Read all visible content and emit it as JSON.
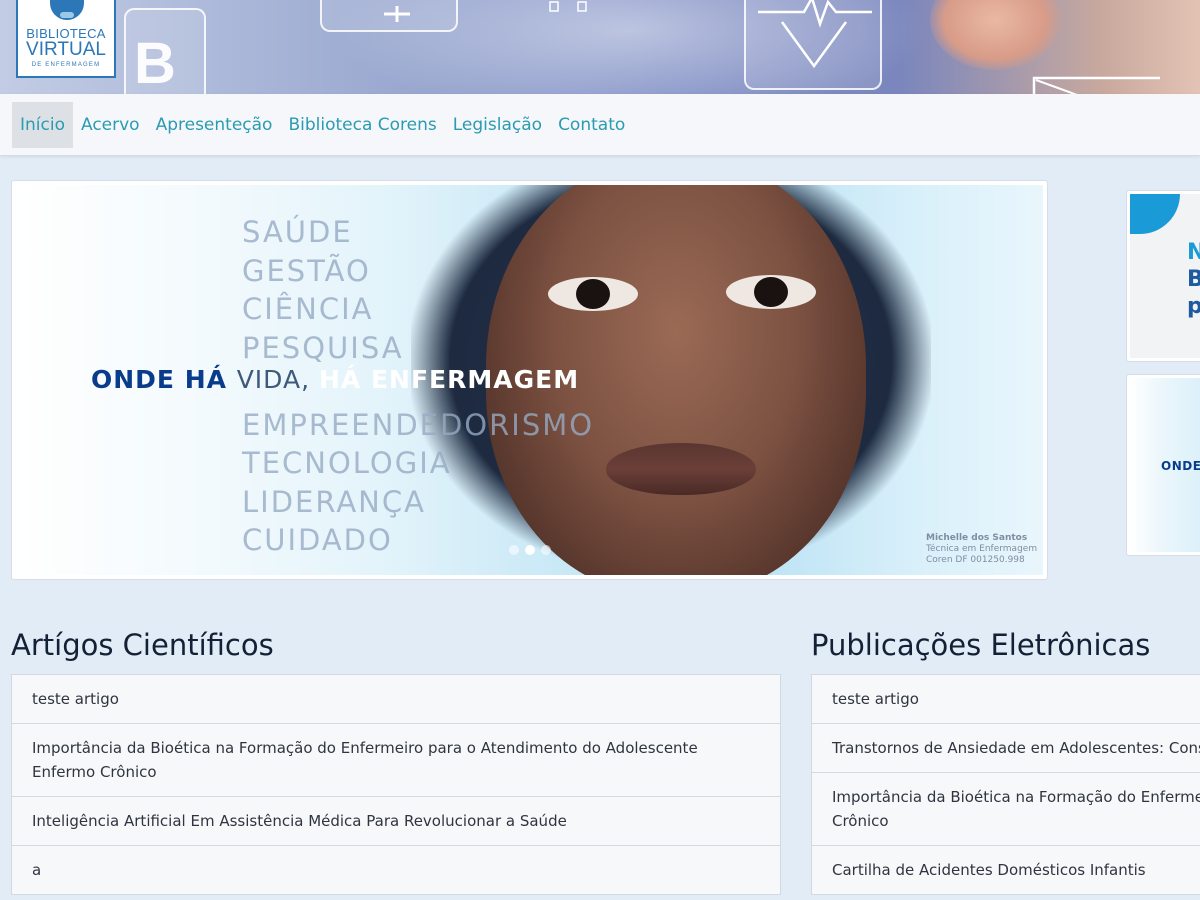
{
  "header": {
    "logo": {
      "line1": "BIBLIOTECA",
      "line2": "VIRTUAL",
      "line3": "DE ENFERMAGEM"
    },
    "decor_letter": "B"
  },
  "nav": {
    "items": [
      {
        "label": "Início",
        "active": true
      },
      {
        "label": "Acervo"
      },
      {
        "label": "Apresenteção"
      },
      {
        "label": "Biblioteca Corens"
      },
      {
        "label": "Legislação"
      },
      {
        "label": "Contato"
      }
    ]
  },
  "carousel": {
    "words": [
      "SAÚDE",
      "GESTÃO",
      "CIÊNCIA",
      "PESQUISA",
      "EMPREENDEDORISMO",
      "TECNOLOGIA",
      "LIDERANÇA",
      "CUIDADO"
    ],
    "slogan": {
      "part1": "ONDE HÁ ",
      "part2": "VIDA, ",
      "part3": "HÁ ENFERMAGEM"
    },
    "caption": {
      "name": "Michelle dos Santos",
      "role": "Técnica em Enfermagem",
      "reg": "Coren DF 001250.998"
    },
    "slide_count": 3,
    "active_slide": 2
  },
  "side_cards": [
    {
      "lines": [
        "N",
        "B",
        "p"
      ]
    },
    {
      "text": "ONDE"
    }
  ],
  "sections": {
    "articles": {
      "title": "Artígos Científicos",
      "items": [
        "teste artigo",
        "Importância da Bioética na Formação do Enfermeiro para o Atendimento do Adolescente Enfermo Crônico",
        "Inteligência Artificial Em Assistência Médica Para Revolucionar a Saúde",
        "a"
      ]
    },
    "publications": {
      "title": "Publicações Eletrônicas",
      "items": [
        "teste artigo",
        "Transtornos de Ansiedade em Adolescentes: Consid",
        "Importância da Bioética na Formação do Enfermeiro",
        "Cartilha de Acidentes Domésticos Infantis"
      ],
      "item3_line2": "Crônico"
    }
  },
  "colors": {
    "nav_link": "#2a9bb1",
    "page_bg": "#e2ecf7",
    "slogan_blue": "#0a3c8c"
  }
}
